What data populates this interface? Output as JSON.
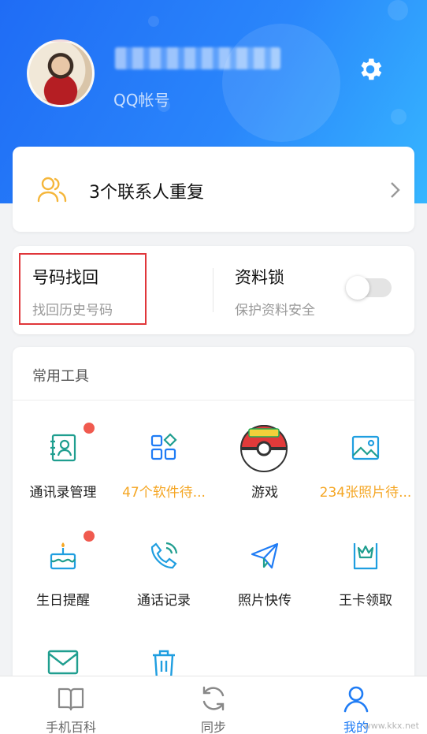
{
  "header": {
    "account_label": "QQ帐号"
  },
  "duplicate_card": {
    "text": "3个联系人重复"
  },
  "features": {
    "recover": {
      "title": "号码找回",
      "subtitle": "找回历史号码"
    },
    "lock": {
      "title": "资料锁",
      "subtitle": "保护资料安全",
      "enabled": false
    }
  },
  "tools": {
    "title": "常用工具",
    "items": [
      {
        "label": "通讯录管理",
        "icon": "contacts-icon",
        "badge": true
      },
      {
        "label": "47个软件待...",
        "icon": "apps-icon",
        "highlight": true
      },
      {
        "label": "游戏",
        "icon": "pokeball-game-icon"
      },
      {
        "label": "234张照片待...",
        "icon": "photo-icon",
        "highlight": true
      },
      {
        "label": "生日提醒",
        "icon": "birthday-cake-icon",
        "badge": true
      },
      {
        "label": "通话记录",
        "icon": "phone-icon"
      },
      {
        "label": "照片快传",
        "icon": "paper-plane-icon"
      },
      {
        "label": "王卡领取",
        "icon": "crown-card-icon"
      },
      {
        "label": "",
        "icon": "mail-icon"
      },
      {
        "label": "",
        "icon": "trash-icon"
      }
    ]
  },
  "tabbar": {
    "items": [
      {
        "label": "手机百科",
        "icon": "book-icon"
      },
      {
        "label": "同步",
        "icon": "sync-icon"
      },
      {
        "label": "我的",
        "icon": "person-icon",
        "active": true
      }
    ]
  },
  "watermark": "www.kkx.net",
  "colors": {
    "accent": "#1f7cf5",
    "highlight": "#f5a623",
    "badge": "#f05a4f",
    "frame": "#e0363a"
  }
}
